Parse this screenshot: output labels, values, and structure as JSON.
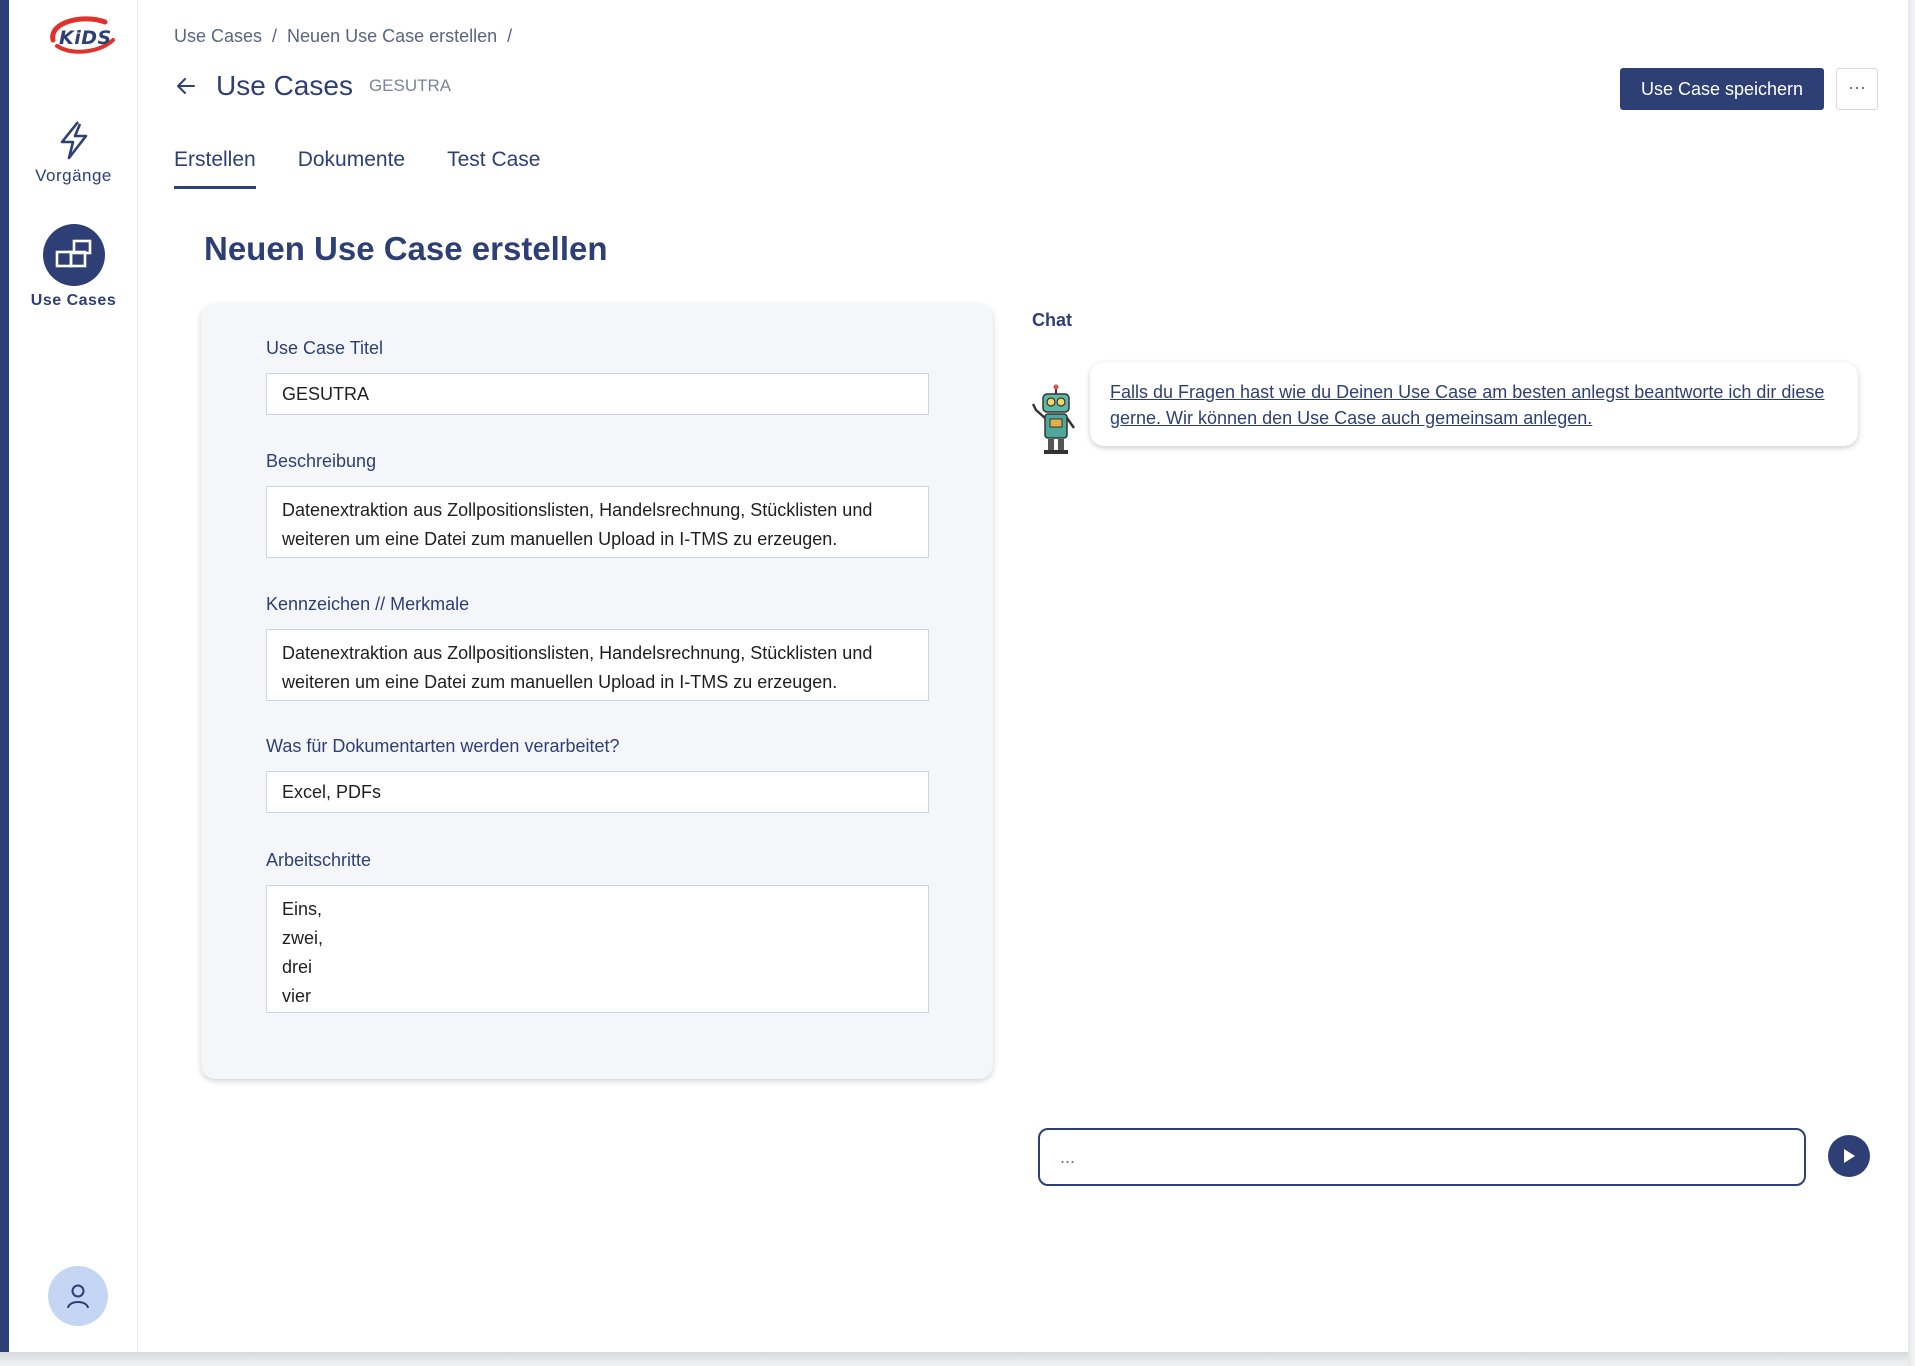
{
  "app": {
    "logo_text": "KiDS",
    "brand_color": "#2e3f75",
    "accent_red": "#e0322d"
  },
  "sidebar": {
    "items": [
      {
        "label": "Vorgänge",
        "icon": "lightning-icon",
        "active": false
      },
      {
        "label": "Use Cases",
        "icon": "blocks-icon",
        "active": true
      }
    ],
    "avatar_icon": "user-icon"
  },
  "breadcrumb": {
    "items": [
      "Use Cases",
      "Neuen Use Case erstellen"
    ],
    "separator": "/"
  },
  "header": {
    "title": "Use Cases",
    "subtitle": "GESUTRA",
    "save_label": "Use Case speichern",
    "more_label": "···"
  },
  "tabs": [
    {
      "label": "Erstellen",
      "active": true
    },
    {
      "label": "Dokumente",
      "active": false
    },
    {
      "label": "Test Case",
      "active": false
    }
  ],
  "section_title": "Neuen Use Case erstellen",
  "form": {
    "title": {
      "label": "Use Case Titel",
      "value": "GESUTRA"
    },
    "description": {
      "label": "Beschreibung",
      "value": "Datenextraktion aus Zollpositionslisten, Handelsrechnung, Stücklisten und weiteren um eine Datei zum manuellen Upload in I-TMS zu erzeugen."
    },
    "features": {
      "label": "Kennzeichen // Merkmale",
      "value": "Datenextraktion aus Zollpositionslisten, Handelsrechnung, Stücklisten und weiteren um eine Datei zum manuellen Upload in I-TMS zu erzeugen."
    },
    "doc_types": {
      "label": "Was für Dokumentarten werden verarbeitet?",
      "value": "Excel, PDFs"
    },
    "steps": {
      "label": "Arbeitschritte",
      "value": "Eins,\nzwei,\ndrei\nvier"
    }
  },
  "chat": {
    "title": "Chat",
    "bot_icon": "robot-icon",
    "message": "Falls du Fragen hast wie du Deinen Use Case am besten anlegst beantworte ich dir diese gerne. Wir können den Use Case auch gemeinsam anlegen.",
    "input_placeholder": "...",
    "send_icon": "play-icon"
  }
}
